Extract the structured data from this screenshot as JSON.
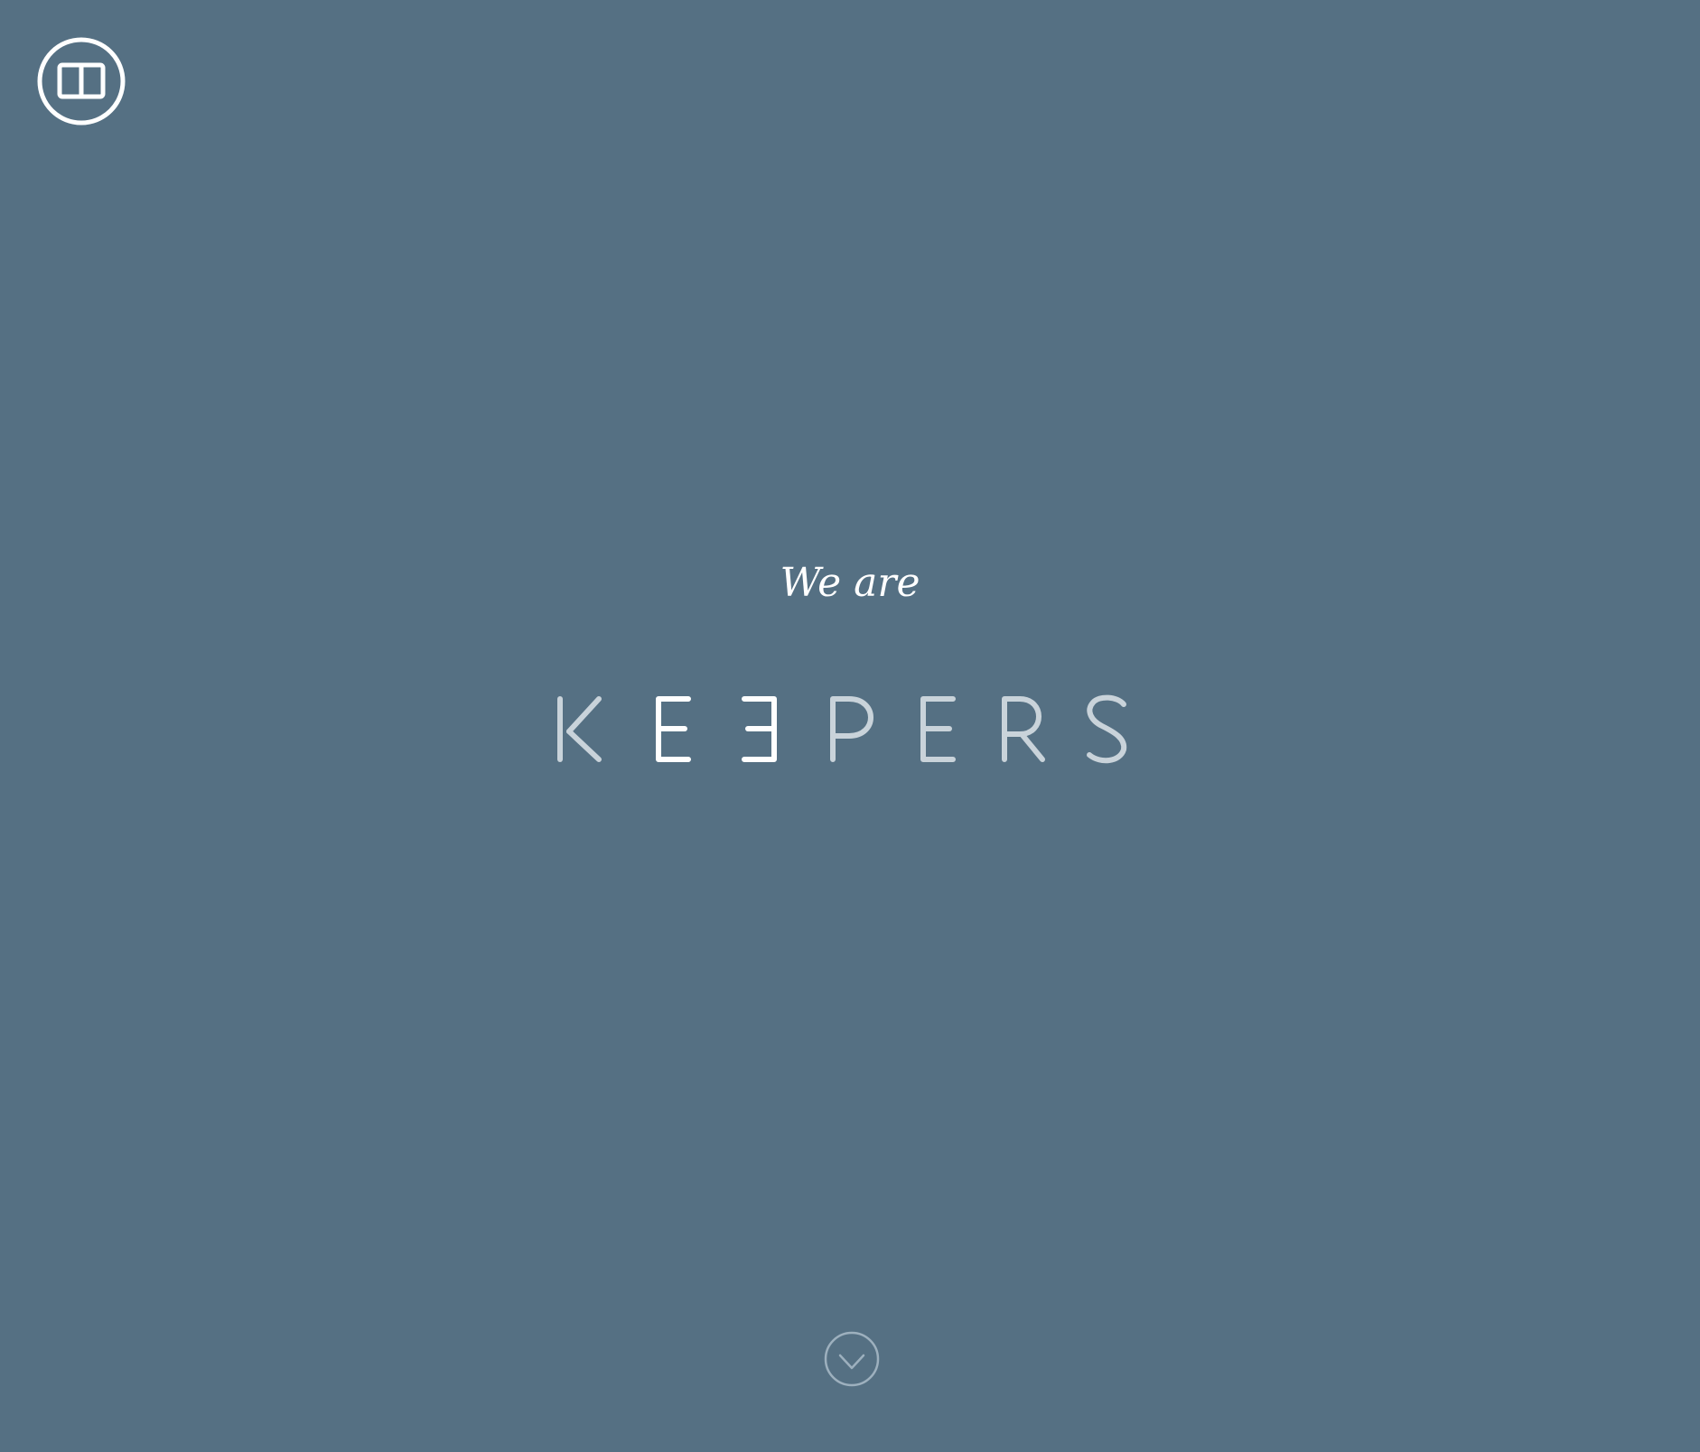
{
  "header": {
    "logo_icon": "book-icon"
  },
  "hero": {
    "tagline": "We are",
    "wordmark": "KEEPERS",
    "letters": [
      {
        "char": "K",
        "emphasis": false
      },
      {
        "char": "E",
        "emphasis": true
      },
      {
        "char": "E",
        "emphasis": true,
        "mirrored": true
      },
      {
        "char": "P",
        "emphasis": false
      },
      {
        "char": "E",
        "emphasis": false
      },
      {
        "char": "R",
        "emphasis": false
      },
      {
        "char": "S",
        "emphasis": false
      }
    ]
  },
  "footer": {
    "scroll_icon": "chevron-down-icon"
  },
  "colors": {
    "background": "#557083",
    "primary": "#ffffff",
    "muted": "#c9d3da",
    "scroll_outline": "#9db0be"
  }
}
